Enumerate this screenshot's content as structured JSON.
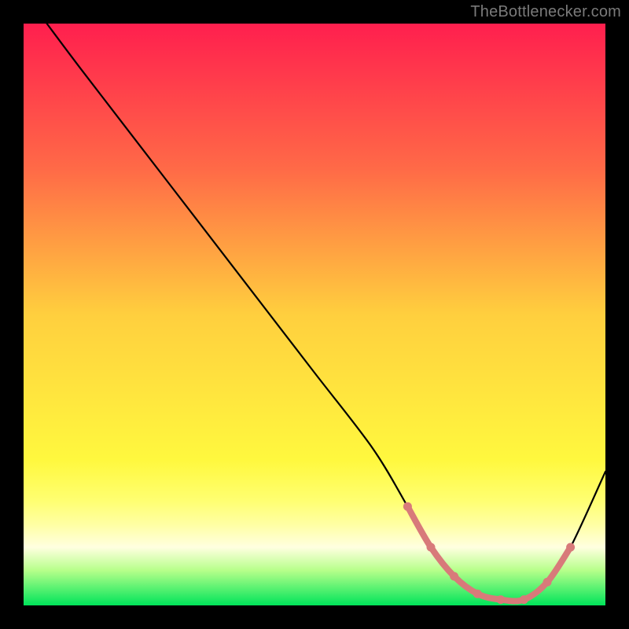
{
  "attribution": "TheBottlenecker.com",
  "chart_data": {
    "type": "line",
    "title": "",
    "xlabel": "",
    "ylabel": "",
    "xlim": [
      0,
      100
    ],
    "ylim": [
      0,
      100
    ],
    "grid": false,
    "series": [
      {
        "name": "curve",
        "x": [
          4,
          10,
          20,
          30,
          40,
          50,
          60,
          66,
          70,
          74,
          78,
          82,
          86,
          90,
          94,
          100
        ],
        "values": [
          100,
          92,
          79,
          66,
          53,
          40,
          27,
          17,
          10,
          5,
          2,
          1,
          1,
          4,
          10,
          23
        ]
      }
    ],
    "flat_marker": {
      "x": [
        66,
        70,
        74,
        78,
        82,
        86,
        90,
        94
      ],
      "values": [
        17,
        10,
        5,
        2,
        1,
        1,
        4,
        10
      ],
      "color": "#d87a7a"
    },
    "background_gradient": {
      "type": "vertical",
      "stops": [
        {
          "offset": 0.0,
          "color": "#ff1f4e"
        },
        {
          "offset": 0.25,
          "color": "#ff6a47"
        },
        {
          "offset": 0.5,
          "color": "#ffcf3e"
        },
        {
          "offset": 0.75,
          "color": "#fff83e"
        },
        {
          "offset": 0.82,
          "color": "#ffff71"
        },
        {
          "offset": 0.86,
          "color": "#ffffa2"
        },
        {
          "offset": 0.9,
          "color": "#ffffe0"
        },
        {
          "offset": 0.94,
          "color": "#b6ff8a"
        },
        {
          "offset": 1.0,
          "color": "#00e45a"
        }
      ]
    }
  }
}
